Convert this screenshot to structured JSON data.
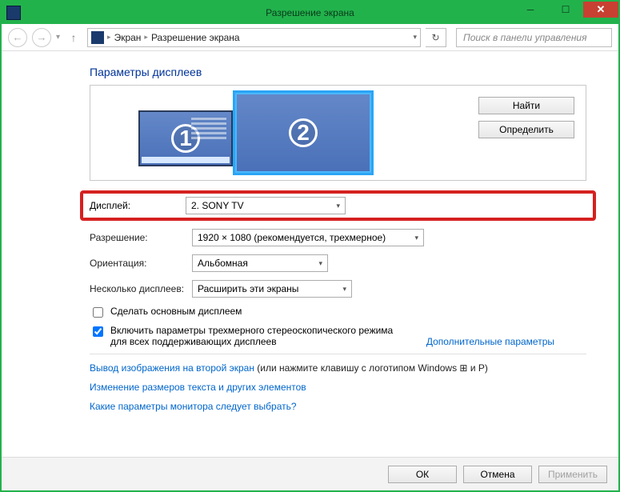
{
  "window": {
    "title": "Разрешение экрана"
  },
  "nav": {
    "crumb1": "Экран",
    "crumb2": "Разрешение экрана",
    "search_placeholder": "Поиск в панели управления"
  },
  "page": {
    "header": "Параметры дисплеев"
  },
  "monitors": {
    "m1": "1",
    "m2": "2"
  },
  "side_buttons": {
    "find": "Найти",
    "detect": "Определить"
  },
  "form": {
    "display_label": "Дисплей:",
    "display_value": "2. SONY TV",
    "resolution_label": "Разрешение:",
    "resolution_value": "1920 × 1080 (рекомендуется, трехмерное)",
    "orientation_label": "Ориентация:",
    "orientation_value": "Альбомная",
    "multi_label": "Несколько дисплеев:",
    "multi_value": "Расширить эти экраны"
  },
  "checks": {
    "make_main": "Сделать основным дисплеем",
    "stereo": "Включить параметры трехмерного стереоскопического режима для всех поддерживающих дисплеев"
  },
  "links": {
    "advanced": "Дополнительные параметры",
    "project": "Вывод изображения на второй экран",
    "project_suffix": " (или нажмите клавишу с логотипом Windows ⊞ и P)",
    "textsize": "Изменение размеров текста и других элементов",
    "which": "Какие параметры монитора следует выбрать?"
  },
  "footer": {
    "ok": "ОК",
    "cancel": "Отмена",
    "apply": "Применить"
  }
}
